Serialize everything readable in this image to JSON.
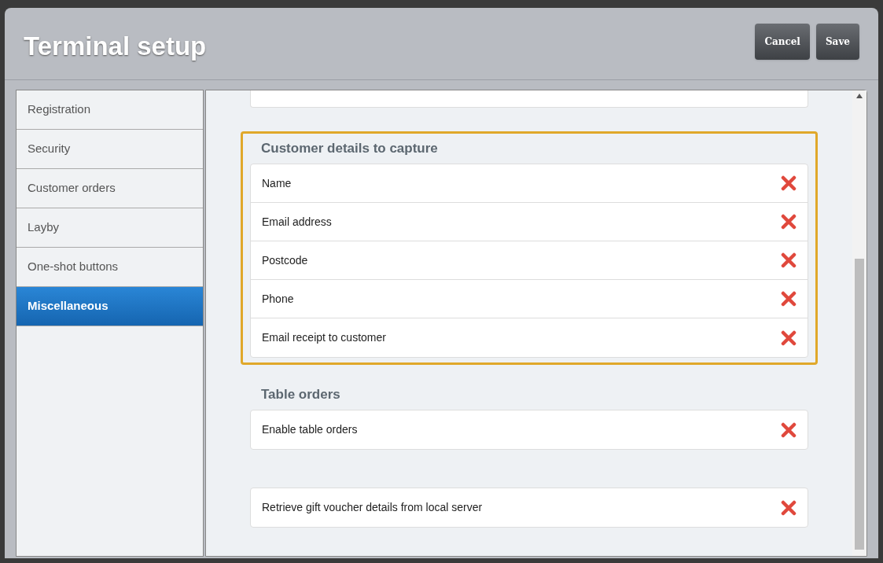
{
  "window": {
    "title": "Terminal setup"
  },
  "buttons": [
    {
      "label": "Cancel"
    },
    {
      "label": "Save"
    }
  ],
  "sidebar": {
    "items": [
      {
        "label": "Registration",
        "selected": false
      },
      {
        "label": "Security",
        "selected": false
      },
      {
        "label": "Customer orders",
        "selected": false
      },
      {
        "label": "Layby",
        "selected": false
      },
      {
        "label": "One-shot buttons",
        "selected": false
      },
      {
        "label": "Miscellaneous",
        "selected": true
      }
    ]
  },
  "sections": [
    {
      "title": "Customer details to capture",
      "highlighted": true,
      "rows": [
        {
          "label": "Name",
          "checked": false
        },
        {
          "label": "Email address",
          "checked": false
        },
        {
          "label": "Postcode",
          "checked": false
        },
        {
          "label": "Phone",
          "checked": false
        },
        {
          "label": "Email receipt to customer",
          "checked": false
        }
      ]
    },
    {
      "title": "Table orders",
      "highlighted": false,
      "rows": [
        {
          "label": "Enable table orders",
          "checked": false
        }
      ]
    },
    {
      "highlighted": false,
      "rows": [
        {
          "label": "Retrieve gift voucher details from local server",
          "checked": false
        }
      ]
    }
  ]
}
